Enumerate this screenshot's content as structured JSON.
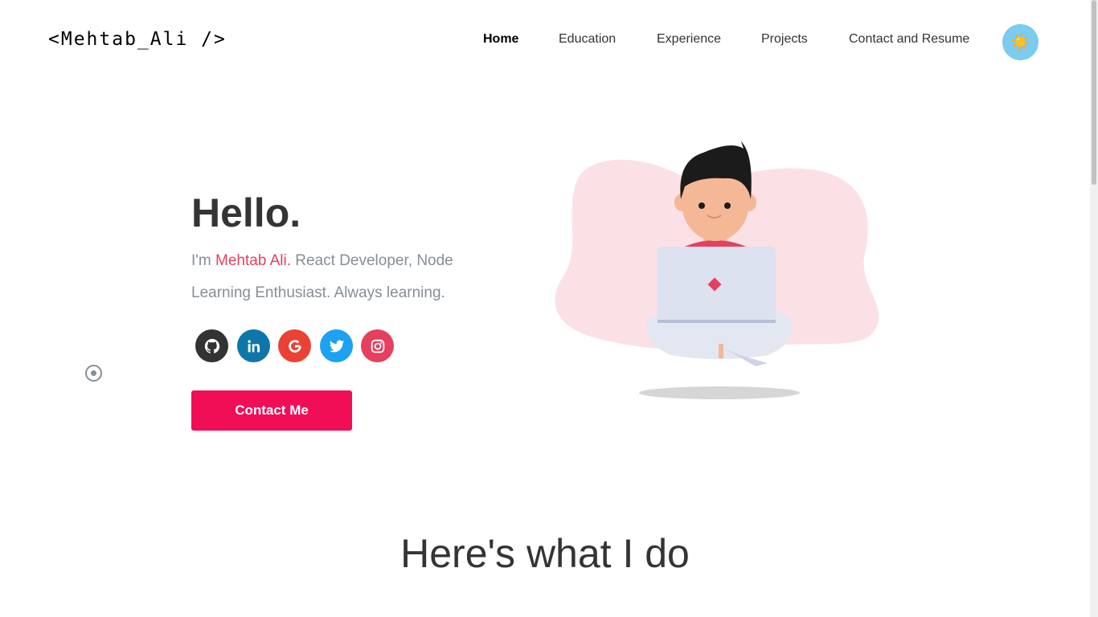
{
  "header": {
    "logo": "<Mehtab_Ali />",
    "nav": [
      {
        "label": "Home"
      },
      {
        "label": "Education"
      },
      {
        "label": "Experience"
      },
      {
        "label": "Projects"
      },
      {
        "label": "Contact and Resume"
      }
    ],
    "theme_toggle_icon": "☀️"
  },
  "hero": {
    "greeting": "Hello.",
    "intro_prefix": "I'm ",
    "name": "Mehtab Ali.",
    "intro_suffix": " React Developer, Node Learning Enthusiast. Always learning.",
    "socials": [
      {
        "icon": "github-icon",
        "color": "#333333"
      },
      {
        "icon": "linkedin-icon",
        "color": "#0e76a8"
      },
      {
        "icon": "google-icon",
        "color": "#ea4335"
      },
      {
        "icon": "twitter-icon",
        "color": "#1da1f2"
      },
      {
        "icon": "instagram-icon",
        "color": "#e4405f"
      }
    ],
    "contact_button": "Contact Me"
  },
  "section": {
    "title": "Here's what I do"
  },
  "colors": {
    "accent": "#f10e56",
    "name_highlight": "#e4405f",
    "theme_toggle": "#7ccbf0",
    "text_muted": "#868e96"
  }
}
